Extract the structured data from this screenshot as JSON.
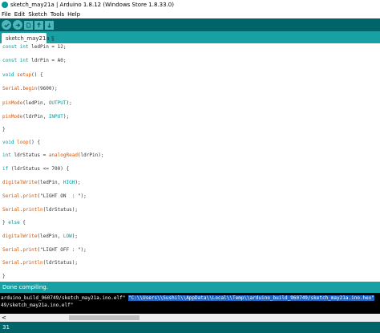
{
  "window": {
    "title": "sketch_may21a | Arduino 1.8.12 (Windows Store 1.8.33.0)"
  },
  "menu": [
    "File",
    "Edit",
    "Sketch",
    "Tools",
    "Help"
  ],
  "toolbar": {
    "buttons": [
      "verify-icon",
      "upload-icon",
      "new-icon",
      "open-icon",
      "save-icon"
    ]
  },
  "tab": {
    "label": "sketch_may21a §"
  },
  "code": {
    "l1": {
      "a": "const int",
      "b": " ledPin = 12;"
    },
    "l2": {
      "a": "const int",
      "b": " ldrPin = A0;"
    },
    "l3": {
      "a": "void",
      "b": " ",
      "c": "setup",
      "d": "() {"
    },
    "l4": {
      "a": "Serial",
      "b": ".",
      "c": "begin",
      "d": "(9600);"
    },
    "l5": {
      "a": "pinMode",
      "b": "(ledPin, ",
      "c": "OUTPUT",
      "d": ");"
    },
    "l6": {
      "a": "pinMode",
      "b": "(ldrPin, ",
      "c": "INPUT",
      "d": ");"
    },
    "l7": "}",
    "l8": {
      "a": "void",
      "b": " ",
      "c": "loop",
      "d": "() {"
    },
    "l9": {
      "a": "int",
      "b": " ldrStatus = ",
      "c": "analogRead",
      "d": "(ldrPin);"
    },
    "l10": {
      "a": "if",
      "b": " (ldrStatus <= 700) {"
    },
    "l11": {
      "a": "digitalWrite",
      "b": "(ledPin, ",
      "c": "HIGH",
      "d": ");"
    },
    "l12": {
      "a": "Serial",
      "b": ".",
      "c": "print",
      "d": "(\"LIGHT ON  : \");"
    },
    "l13": {
      "a": "Serial",
      "b": ".",
      "c": "println",
      "d": "(ldrStatus);"
    },
    "l14": {
      "a": "} ",
      "b": "else",
      "c": " {"
    },
    "l15": {
      "a": "digitalWrite",
      "b": "(ledPin, ",
      "c": "LOW",
      "d": ");"
    },
    "l16": {
      "a": "Serial",
      "b": ".",
      "c": "print",
      "d": "(\"LIGHT OFF : \");"
    },
    "l17": {
      "a": "Serial",
      "b": ".",
      "c": "println",
      "d": "(ldrStatus);"
    },
    "l18": "}"
  },
  "status": {
    "message": "Done compiling."
  },
  "console": {
    "line1_a": "arduino_build_960749/sketch_may21a.ino.elf\" ",
    "line1_sel": "\"C:\\\\Users\\\\Sushil\\\\AppData\\\\Local\\\\Temp\\\\arduino_build_960749/sketch_may21a.ino.hex\"",
    "line2": "49/sketch_may21a.ino.elf\""
  },
  "scroll": {
    "left_arrow": "<"
  },
  "footer": {
    "line_number": "31"
  },
  "colors": {
    "toolbar": "#006468",
    "tabbar": "#17a1a5",
    "button": "#4db7bb",
    "keyword": "#00979c",
    "function": "#d35400",
    "selection": "#1e66c8"
  }
}
